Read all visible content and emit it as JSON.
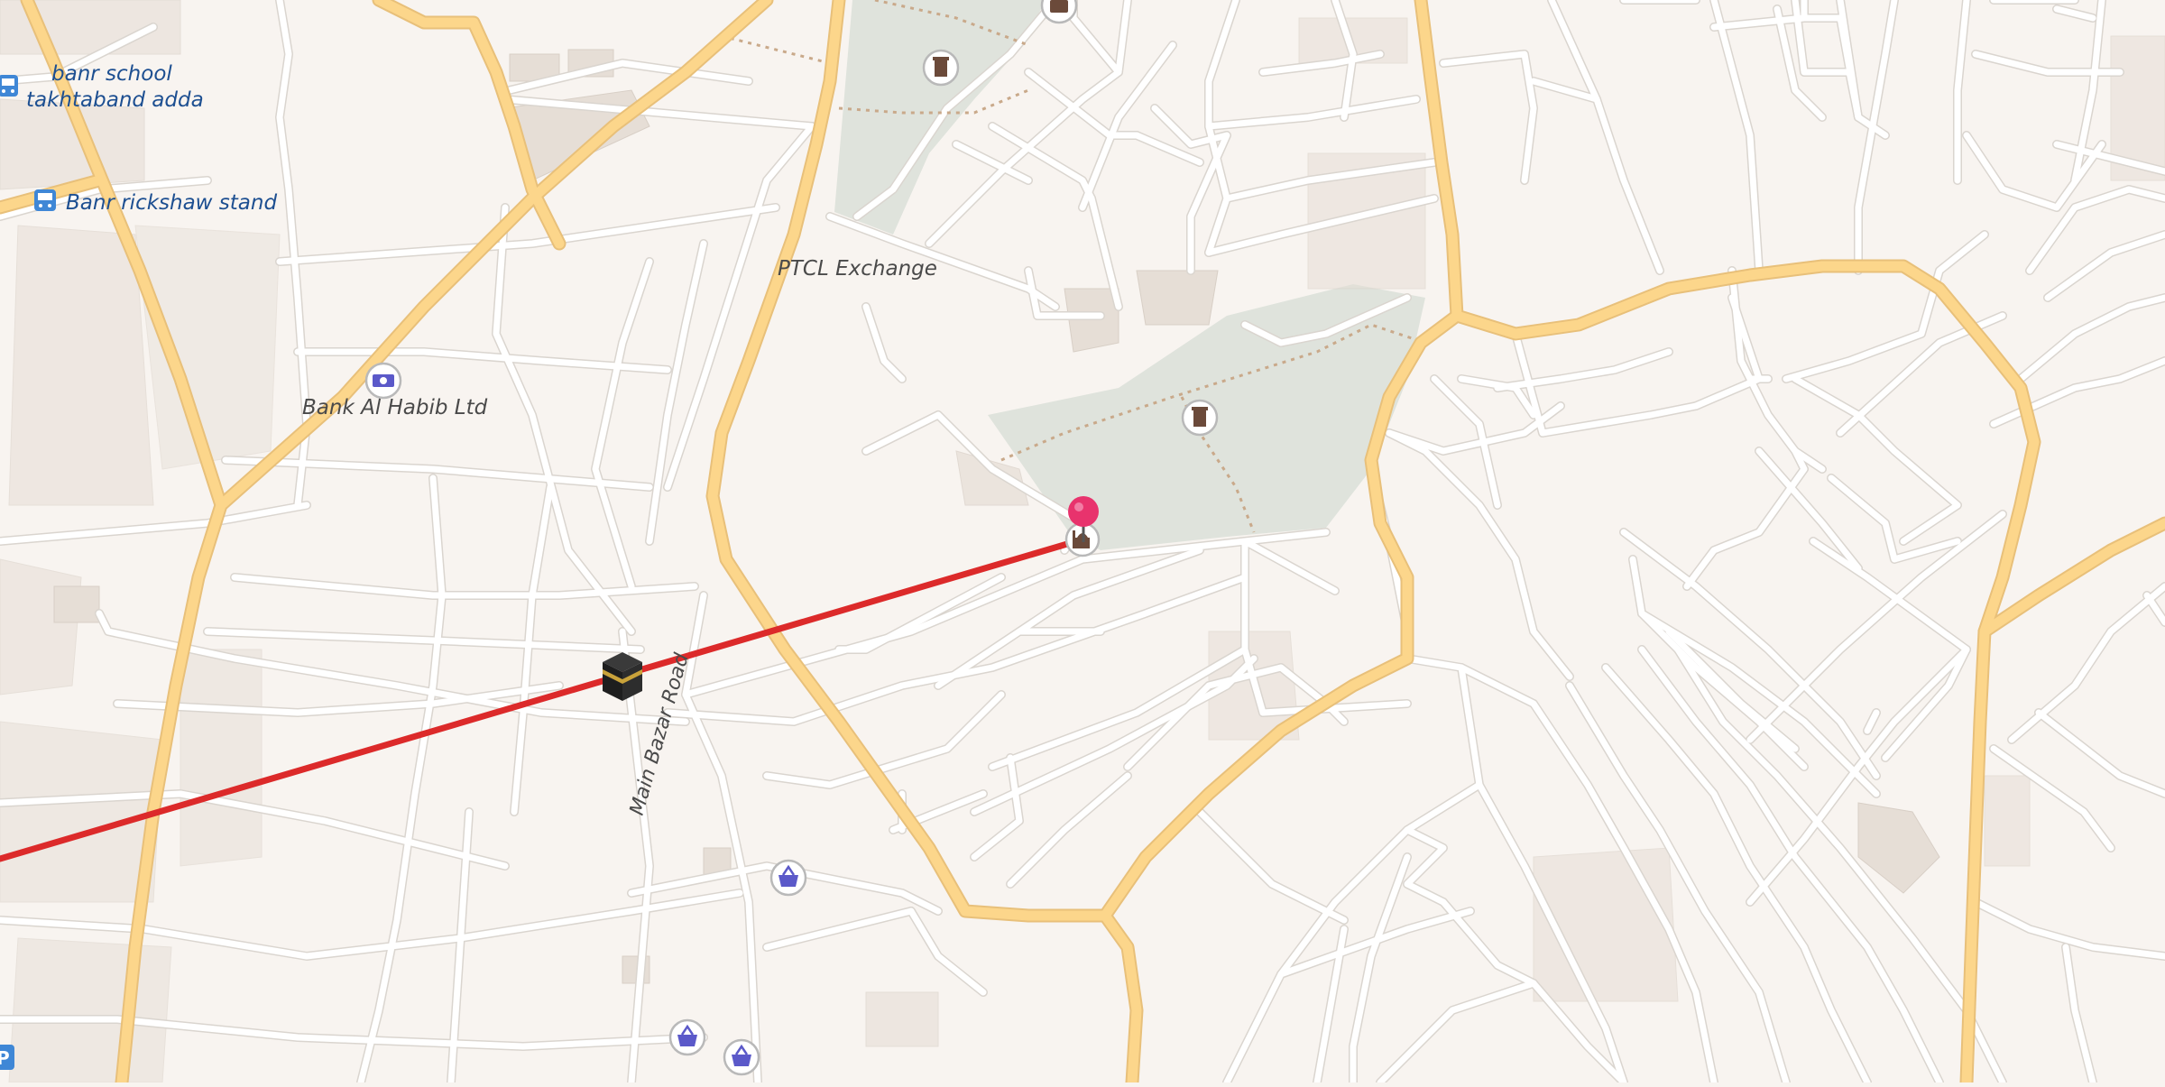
{
  "map": {
    "place_labels": {
      "banr_school": "banr school",
      "takhtaband_adda": "takhtaband adda",
      "banr_rickshaw_stand": "Banr rickshaw stand",
      "ptcl_exchange": "PTCL Exchange",
      "bank_al_habib": "Bank Al Habib Ltd",
      "main_bazar_road": "Main Bazar Road"
    },
    "icons": {
      "bus_stop": "bus-icon",
      "bank": "bank-icon",
      "shop": "basket-icon",
      "cemetery": "grave-icon",
      "mosque": "mosque-icon",
      "kaaba": "kaaba-icon",
      "marker": "pin-marker-icon",
      "suitcase": "suitcase-icon",
      "parking": "parking-icon"
    },
    "colors": {
      "background": "#f8f4f0",
      "park": "#dfe3dc",
      "main_road": "#fcd68b",
      "minor_road": "#ffffff",
      "route_line": "#dc2a2a",
      "marker": "#e8336d",
      "label_blue": "#1d4f91",
      "shop_icon": "#5b59c9"
    }
  }
}
